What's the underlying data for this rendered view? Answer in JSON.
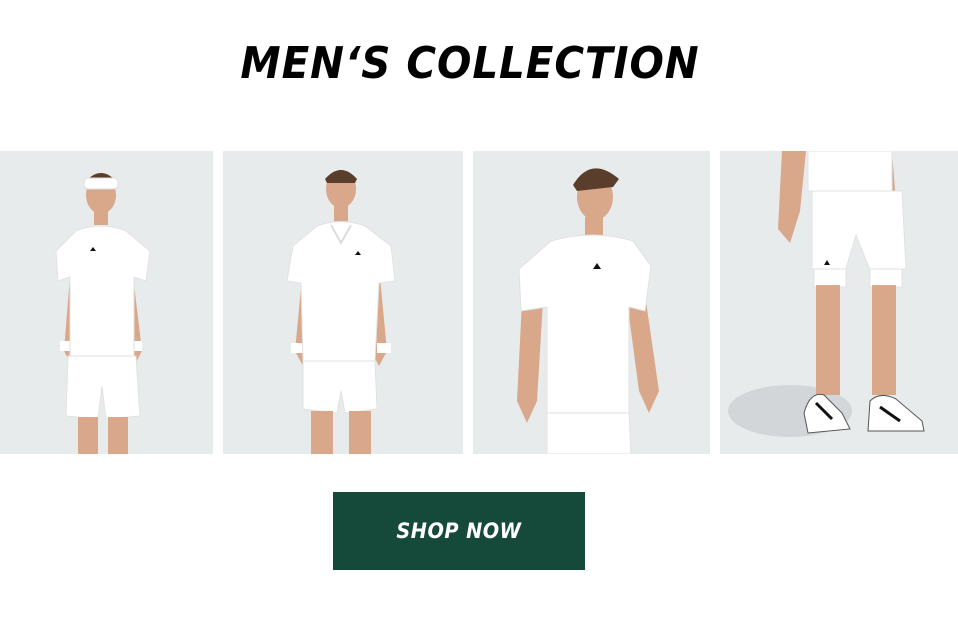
{
  "heading": "MEN‘S COLLECTION",
  "products": [
    {
      "name": "headband-tee-shorts-model"
    },
    {
      "name": "polo-shorts-model"
    },
    {
      "name": "crew-tee-model"
    },
    {
      "name": "shorts-shoes-model"
    }
  ],
  "cta": {
    "label": "SHOP NOW",
    "color": "#15493a"
  },
  "colors": {
    "tile_background": "#e7ebec",
    "apparel": "#ffffff",
    "text": "#000000"
  }
}
